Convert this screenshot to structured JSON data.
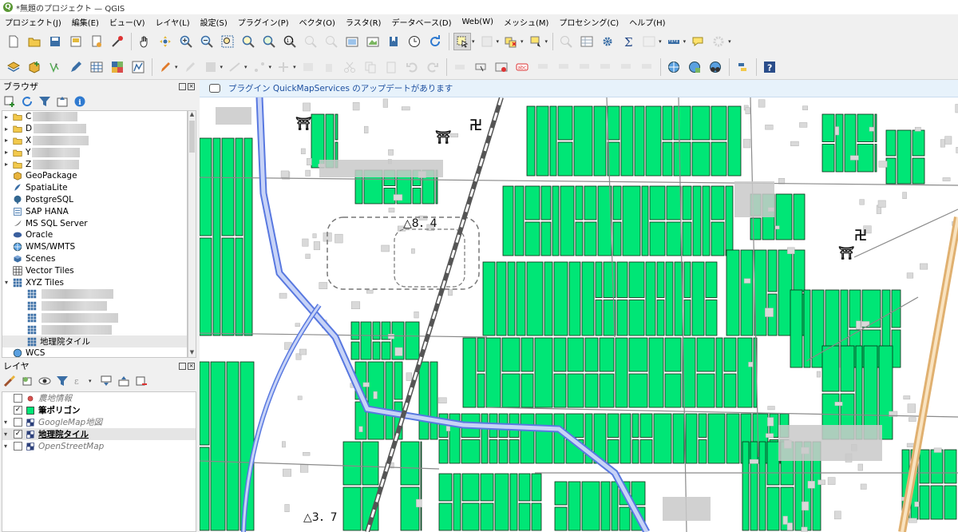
{
  "window": {
    "title": "*無題のプロジェクト — QGIS",
    "logo_letter": "Q"
  },
  "menu": [
    "プロジェクト(J)",
    "編集(E)",
    "ビュー(V)",
    "レイヤ(L)",
    "設定(S)",
    "プラグイン(P)",
    "ベクタ(O)",
    "ラスタ(R)",
    "データベース(D)",
    "Web(W)",
    "メッシュ(M)",
    "プロセシング(C)",
    "ヘルプ(H)"
  ],
  "browser_panel": {
    "title": "ブラウザ",
    "items": [
      {
        "label": "C",
        "type": "drive",
        "icon": "folder-icon"
      },
      {
        "label": "D",
        "type": "drive",
        "icon": "folder-icon"
      },
      {
        "label": "X",
        "type": "drive",
        "icon": "folder-icon"
      },
      {
        "label": "Y",
        "type": "drive",
        "icon": "folder-icon"
      },
      {
        "label": "Z",
        "type": "drive",
        "icon": "folder-icon"
      },
      {
        "label": "GeoPackage",
        "icon": "geopackage-icon"
      },
      {
        "label": "SpatiaLite",
        "icon": "spatialite-icon"
      },
      {
        "label": "PostgreSQL",
        "icon": "postgresql-icon"
      },
      {
        "label": "SAP HANA",
        "icon": "saphana-icon"
      },
      {
        "label": "MS SQL Server",
        "icon": "mssql-icon"
      },
      {
        "label": "Oracle",
        "icon": "oracle-icon"
      },
      {
        "label": "WMS/WMTS",
        "icon": "wms-icon"
      },
      {
        "label": "Scenes",
        "icon": "scenes-icon"
      },
      {
        "label": "Vector Tiles",
        "icon": "vectortiles-icon"
      },
      {
        "label": "XYZ Tiles",
        "icon": "xyz-tiles-icon"
      },
      {
        "label": "地理院タイル",
        "icon": "xyz-tiles-icon"
      },
      {
        "label": "WCS",
        "icon": "wcs-icon"
      }
    ]
  },
  "layers_panel": {
    "title": "レイヤ",
    "layers": [
      {
        "name": "農地情報",
        "checked": false,
        "style": "italic",
        "icon": "point-layer-icon"
      },
      {
        "name": "筆ポリゴン",
        "checked": true,
        "style": "bold",
        "icon": "polygon-layer-icon"
      },
      {
        "name": "GoogleMap地図",
        "checked": false,
        "style": "italic",
        "icon": "raster-layer-icon"
      },
      {
        "name": "地理院タイル",
        "checked": true,
        "style": "bold-underline",
        "icon": "raster-layer-icon"
      },
      {
        "name": "OpenStreetMap",
        "checked": false,
        "style": "italic",
        "icon": "raster-layer-icon"
      }
    ]
  },
  "message_bar": {
    "text": "プラグイン QuickMapServices のアップデートがあります"
  },
  "map": {
    "elevation_labels": [
      "△8．4",
      "△3．7"
    ],
    "colors": {
      "parcel_fill": "#00e676",
      "parcel_stroke": "#0a2a14",
      "water": "#5878e0",
      "railway": "#555555",
      "expressway": "#e0b070",
      "building": "#d9d9d9"
    }
  },
  "colors": {
    "accent": "#1e50a0",
    "panel_bg": "#f0f0f0"
  }
}
